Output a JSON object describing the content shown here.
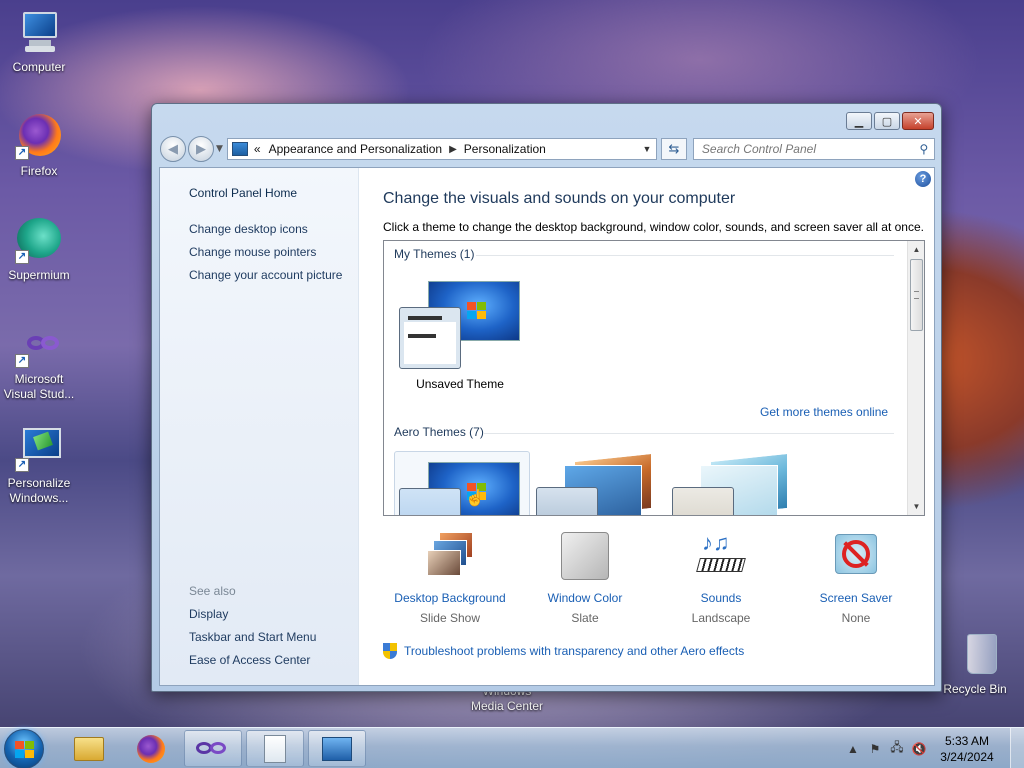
{
  "desktop": {
    "icons": [
      {
        "label": "Computer"
      },
      {
        "label": "Firefox"
      },
      {
        "label": "Supermium"
      },
      {
        "label": "Microsoft Visual Stud..."
      },
      {
        "label": "Personalize Windows..."
      },
      {
        "label": "Windows Media Center"
      },
      {
        "label": "Recycle Bin"
      }
    ]
  },
  "window": {
    "address": {
      "prefix": "«",
      "crumbs": [
        "Appearance and Personalization",
        "Personalization"
      ]
    },
    "search_placeholder": "Search Control Panel",
    "sidebar": {
      "home": "Control Panel Home",
      "links": [
        "Change desktop icons",
        "Change mouse pointers",
        "Change your account picture"
      ],
      "see_also_label": "See also",
      "see_also": [
        "Display",
        "Taskbar and Start Menu",
        "Ease of Access Center"
      ]
    },
    "main": {
      "title": "Change the visuals and sounds on your computer",
      "subtitle": "Click a theme to change the desktop background, window color, sounds, and screen saver all at once.",
      "my_themes_label": "My Themes (1)",
      "unsaved_theme": "Unsaved Theme",
      "get_more_link": "Get more themes online",
      "aero_themes_label": "Aero Themes (7)",
      "settings": [
        {
          "label": "Desktop Background",
          "value": "Slide Show"
        },
        {
          "label": "Window Color",
          "value": "Slate"
        },
        {
          "label": "Sounds",
          "value": "Landscape"
        },
        {
          "label": "Screen Saver",
          "value": "None"
        }
      ],
      "troubleshoot_link": "Troubleshoot problems with transparency and other Aero effects"
    }
  },
  "taskbar": {
    "time": "5:33 AM",
    "date": "3/24/2024"
  },
  "colors": {
    "link": "#1a5fb4",
    "title": "#1e395b",
    "close_button": "#c5412b"
  }
}
